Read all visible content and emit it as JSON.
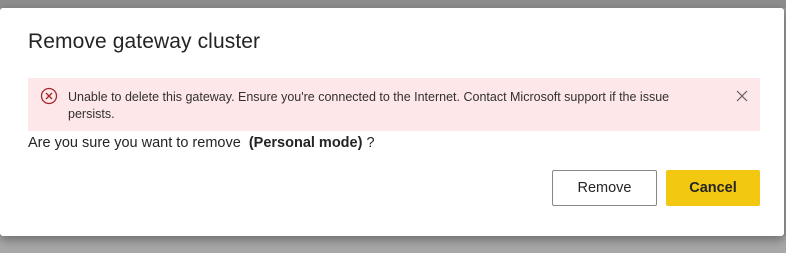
{
  "dialog": {
    "title": "Remove gateway cluster",
    "error": {
      "message": "Unable to delete this gateway. Ensure you're connected to the Internet. Contact Microsoft support if the issue persists.",
      "icon": "error-circle-icon",
      "dismiss_icon": "close-icon"
    },
    "question": {
      "prefix": "Are you sure you want to remove  ",
      "name": "(Personal mode)",
      "suffix": " ?"
    },
    "buttons": {
      "remove_label": "Remove",
      "cancel_label": "Cancel"
    },
    "colors": {
      "error_background": "#fde7e9",
      "error_icon": "#a4262c",
      "primary_button": "#f2c811"
    }
  }
}
